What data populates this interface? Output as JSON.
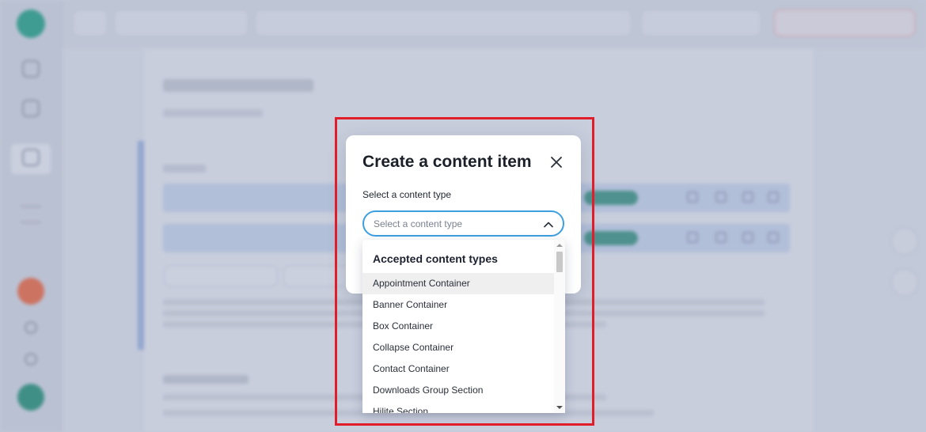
{
  "modal": {
    "title": "Create a content item",
    "field_label": "Select a content type",
    "select_placeholder": "Select a content type"
  },
  "dropdown": {
    "header": "Accepted content types",
    "items": [
      "Appointment Container",
      "Banner Container",
      "Box Container",
      "Collapse Container",
      "Contact Container",
      "Downloads Group Section",
      "Hilite Section"
    ],
    "hovered_index": 0
  },
  "icons": {
    "close": "close-icon",
    "chevron": "chevron-up-icon"
  },
  "colors": {
    "highlight_border": "#e11d2a",
    "select_border": "#3d9fe0",
    "brand": "#2d9b8a"
  }
}
